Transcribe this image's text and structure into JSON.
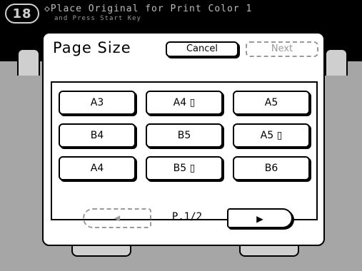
{
  "status": {
    "counter": "18",
    "message": "◇Place Original for Print Color 1",
    "sub_message": "and Press Start Key"
  },
  "dialog": {
    "title": "Page Size",
    "cancel_label": "Cancel",
    "next_label": "Next",
    "sizes": [
      [
        "A3",
        "A4 ▯",
        "A5"
      ],
      [
        "B4",
        "B5",
        "A5 ▯"
      ],
      [
        "A4",
        "B5 ▯",
        "B6"
      ]
    ],
    "page_indicator": "P.1/2",
    "prev_icon": "◀",
    "next_icon": "▶"
  }
}
